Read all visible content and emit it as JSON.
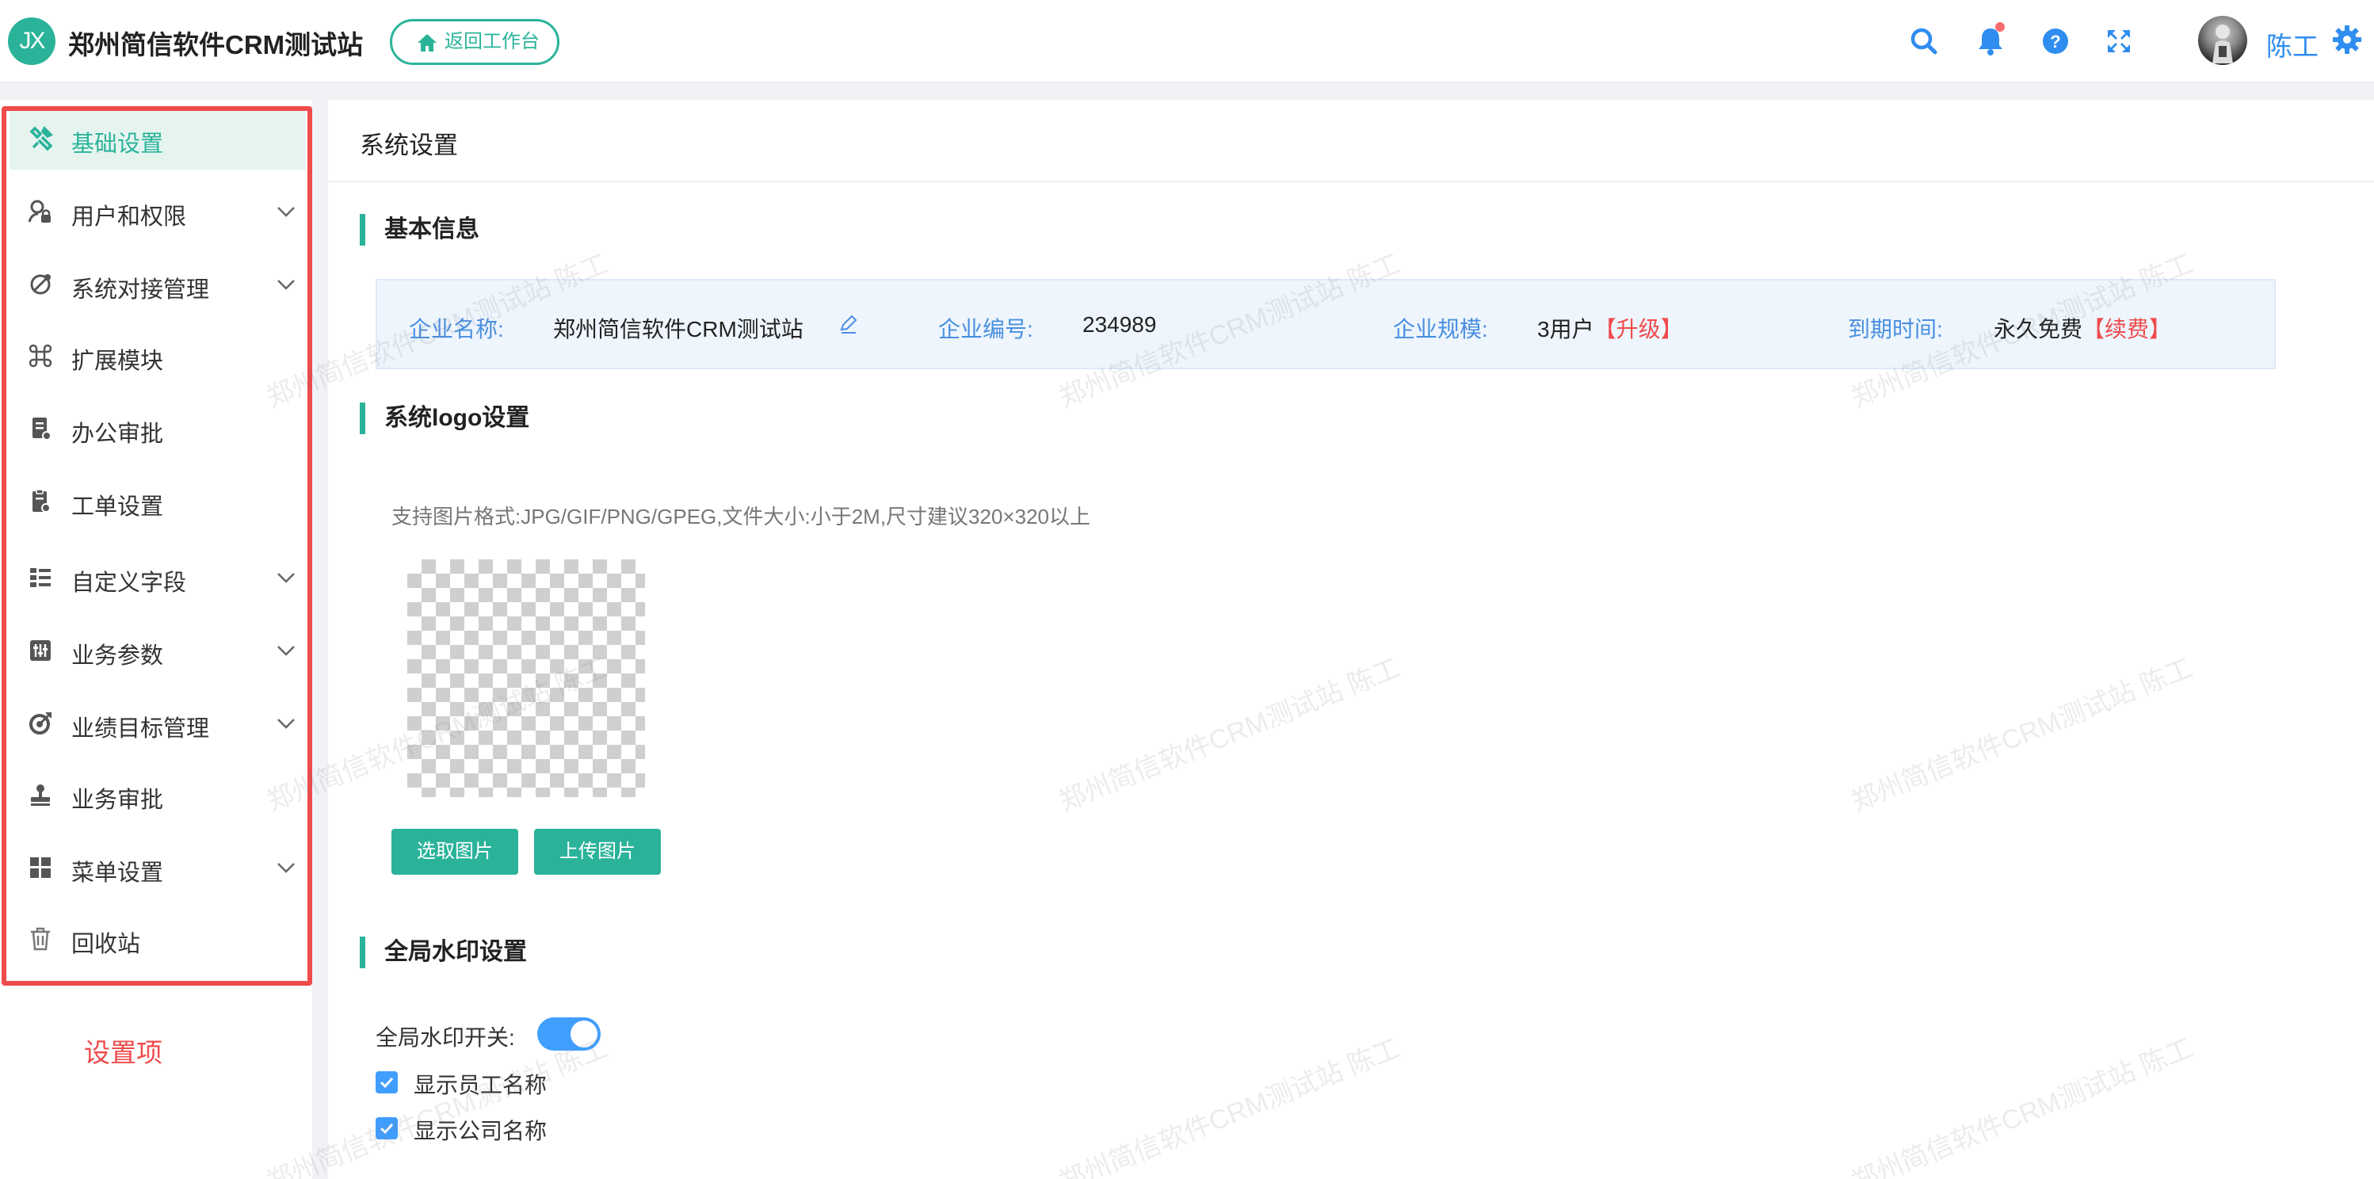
{
  "header": {
    "logo_text": "JX",
    "app_title": "郑州简信软件CRM测试站",
    "back_button": "返回工作台",
    "user_name": "陈工",
    "icons": [
      "search-icon",
      "bell-icon",
      "help-icon",
      "fullscreen-icon",
      "gear-icon"
    ],
    "accent_color": "#2bb39a"
  },
  "sidebar": {
    "items": [
      {
        "label": "基础设置",
        "icon": "wrench-icon",
        "active": true,
        "expandable": false
      },
      {
        "label": "用户和权限",
        "icon": "user-lock-icon",
        "active": false,
        "expandable": true
      },
      {
        "label": "系统对接管理",
        "icon": "link-icon",
        "active": false,
        "expandable": true
      },
      {
        "label": "扩展模块",
        "icon": "command-icon",
        "active": false,
        "expandable": false
      },
      {
        "label": "办公审批",
        "icon": "document-icon",
        "active": false,
        "expandable": false
      },
      {
        "label": "工单设置",
        "icon": "clipboard-icon",
        "active": false,
        "expandable": false
      },
      {
        "label": "自定义字段",
        "icon": "list-icon",
        "active": false,
        "expandable": true
      },
      {
        "label": "业务参数",
        "icon": "sliders-icon",
        "active": false,
        "expandable": true
      },
      {
        "label": "业绩目标管理",
        "icon": "target-icon",
        "active": false,
        "expandable": true
      },
      {
        "label": "业务审批",
        "icon": "stamp-icon",
        "active": false,
        "expandable": false
      },
      {
        "label": "菜单设置",
        "icon": "grid-icon",
        "active": false,
        "expandable": true
      },
      {
        "label": "回收站",
        "icon": "trash-icon",
        "active": false,
        "expandable": false
      }
    ],
    "annotation": "设置项"
  },
  "main": {
    "page_title": "系统设置",
    "basic_info": {
      "title": "基本信息",
      "company_name_label": "企业名称:",
      "company_name_value": "郑州简信软件CRM测试站",
      "company_no_label": "企业编号:",
      "company_no_value": "234989",
      "scale_label": "企业规模:",
      "scale_value": "3用户",
      "scale_action": "【升级】",
      "expire_label": "到期时间:",
      "expire_value": "永久免费",
      "expire_action": "【续费】"
    },
    "logo": {
      "title": "系统logo设置",
      "hint": "支持图片格式:JPG/GIF/PNG/GPEG,文件大小:小于2M,尺寸建议320×320以上",
      "select_button": "选取图片",
      "upload_button": "上传图片"
    },
    "watermark": {
      "title": "全局水印设置",
      "switch_label": "全局水印开关:",
      "switch_on": true,
      "show_employee_label": "显示员工名称",
      "show_employee_checked": true,
      "show_company_label": "显示公司名称",
      "show_company_checked": true,
      "overlay_text": "郑州简信软件CRM测试站 陈工"
    }
  }
}
